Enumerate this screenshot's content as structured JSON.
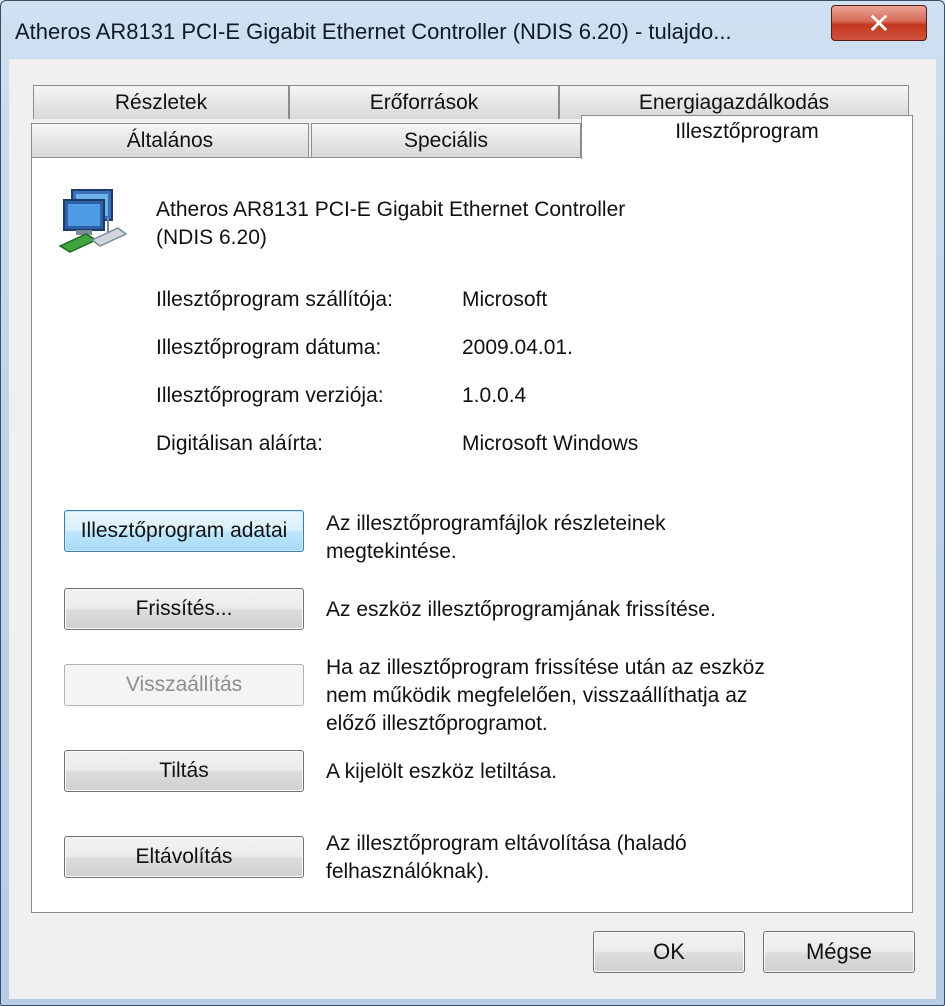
{
  "window": {
    "title": "Atheros AR8131 PCI-E Gigabit Ethernet Controller (NDIS 6.20) - tulajdo...",
    "close_glyph": "✕"
  },
  "tabs": {
    "row_back": [
      {
        "label": "Részletek"
      },
      {
        "label": "Erőforrások"
      },
      {
        "label": "Energiagazdálkodás"
      }
    ],
    "row_front": [
      {
        "label": "Általános"
      },
      {
        "label": "Speciális"
      },
      {
        "label": "Illesztőprogram",
        "active": true
      }
    ]
  },
  "device": {
    "icon": "network-adapter-icon",
    "name_line1": "Atheros AR8131 PCI-E Gigabit Ethernet Controller",
    "name_line2": "(NDIS 6.20)"
  },
  "properties": [
    {
      "label": "Illesztőprogram szállítója:",
      "value": "Microsoft"
    },
    {
      "label": "Illesztőprogram dátuma:",
      "value": "2009.04.01."
    },
    {
      "label": "Illesztőprogram verziója:",
      "value": "1.0.0.4"
    },
    {
      "label": "Digitálisan aláírta:",
      "value": "Microsoft Windows"
    }
  ],
  "actions": [
    {
      "label": "Illesztőprogram adatai",
      "state": "focused",
      "desc_lines": [
        "Az illesztőprogramfájlok részleteinek",
        "megtekintése."
      ]
    },
    {
      "label": "Frissítés...",
      "state": "normal",
      "desc_lines": [
        "Az eszköz illesztőprogramjának frissítése."
      ]
    },
    {
      "label": "Visszaállítás",
      "state": "disabled",
      "desc_lines": [
        "Ha az illesztőprogram frissítése után az eszköz",
        "nem működik megfelelően, visszaállíthatja az",
        "előző illesztőprogramot."
      ]
    },
    {
      "label": "Tiltás",
      "state": "normal",
      "desc_lines": [
        "A kijelölt eszköz letiltása."
      ]
    },
    {
      "label": "Eltávolítás",
      "state": "normal",
      "desc_lines": [
        "Az illesztőprogram eltávolítása (haladó",
        "felhasználóknak)."
      ]
    }
  ],
  "footer": {
    "ok_label": "OK",
    "cancel_label": "Mégse"
  },
  "colors": {
    "focused_button": "#bee6fd",
    "close_button": "#c2371f",
    "window_frame": "#b4cce6"
  }
}
